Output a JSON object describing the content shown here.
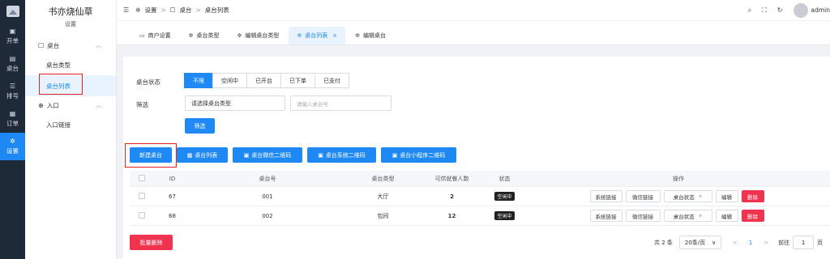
{
  "rail": {
    "items": [
      {
        "label": "开单",
        "icon": "briefcase-icon"
      },
      {
        "label": "桌台",
        "icon": "table-icon"
      },
      {
        "label": "排号",
        "icon": "list-icon"
      },
      {
        "label": "订单",
        "icon": "document-icon"
      },
      {
        "label": "设置",
        "icon": "gear-icon",
        "active": true
      }
    ]
  },
  "sidebar": {
    "brand_title": "书亦烧仙草",
    "brand_subtitle": "设置",
    "group1": "桌台",
    "item1": "桌台类型",
    "item2": "桌台列表",
    "group2": "入口",
    "item3": "入口链接"
  },
  "header": {
    "crumb1": "设置",
    "crumb2": "桌台",
    "crumb3": "桌台列表",
    "user": "admin"
  },
  "tabs": [
    "商户设置",
    "桌台类型",
    "编辑桌台类型",
    "桌台列表",
    "编辑桌台"
  ],
  "filters": {
    "status_label": "桌台状态",
    "status_options": [
      "不限",
      "空闲中",
      "已开台",
      "已下单",
      "已支付"
    ],
    "filter_label": "筛选",
    "type_select": "请选择桌台类型",
    "number_placeholder": "请输入桌台号",
    "submit": "筛选"
  },
  "actions": {
    "new": "新建桌台",
    "list": "桌台列表",
    "wechat_qr": "桌台微信二维码",
    "system_qr": "桌台系统二维码",
    "mini_qr": "桌台小程序二维码"
  },
  "table": {
    "columns": [
      "ID",
      "桌台号",
      "桌台类型",
      "可供就餐人数",
      "状态",
      "操作"
    ],
    "rows": [
      {
        "id": "67",
        "number": "001",
        "type": "大厅",
        "capacity": "2",
        "status": "空闲中"
      },
      {
        "id": "68",
        "number": "002",
        "type": "包间",
        "capacity": "12",
        "status": "空闲中"
      }
    ],
    "op_system_link": "系统链接",
    "op_wechat_link": "微信链接",
    "op_status": "桌台状态",
    "op_edit": "编辑",
    "op_delete": "删除"
  },
  "bulk_delete": "批量删除",
  "pagination": {
    "total": "共 2 条",
    "page_size": "20条/页",
    "current": "1",
    "goto_label": "前往",
    "goto_value": "1",
    "page_unit": "页"
  },
  "colors": {
    "primary": "#1e88f5",
    "danger": "#f0344f",
    "rail_bg": "#1f2a38",
    "highlight": "#e02424"
  }
}
